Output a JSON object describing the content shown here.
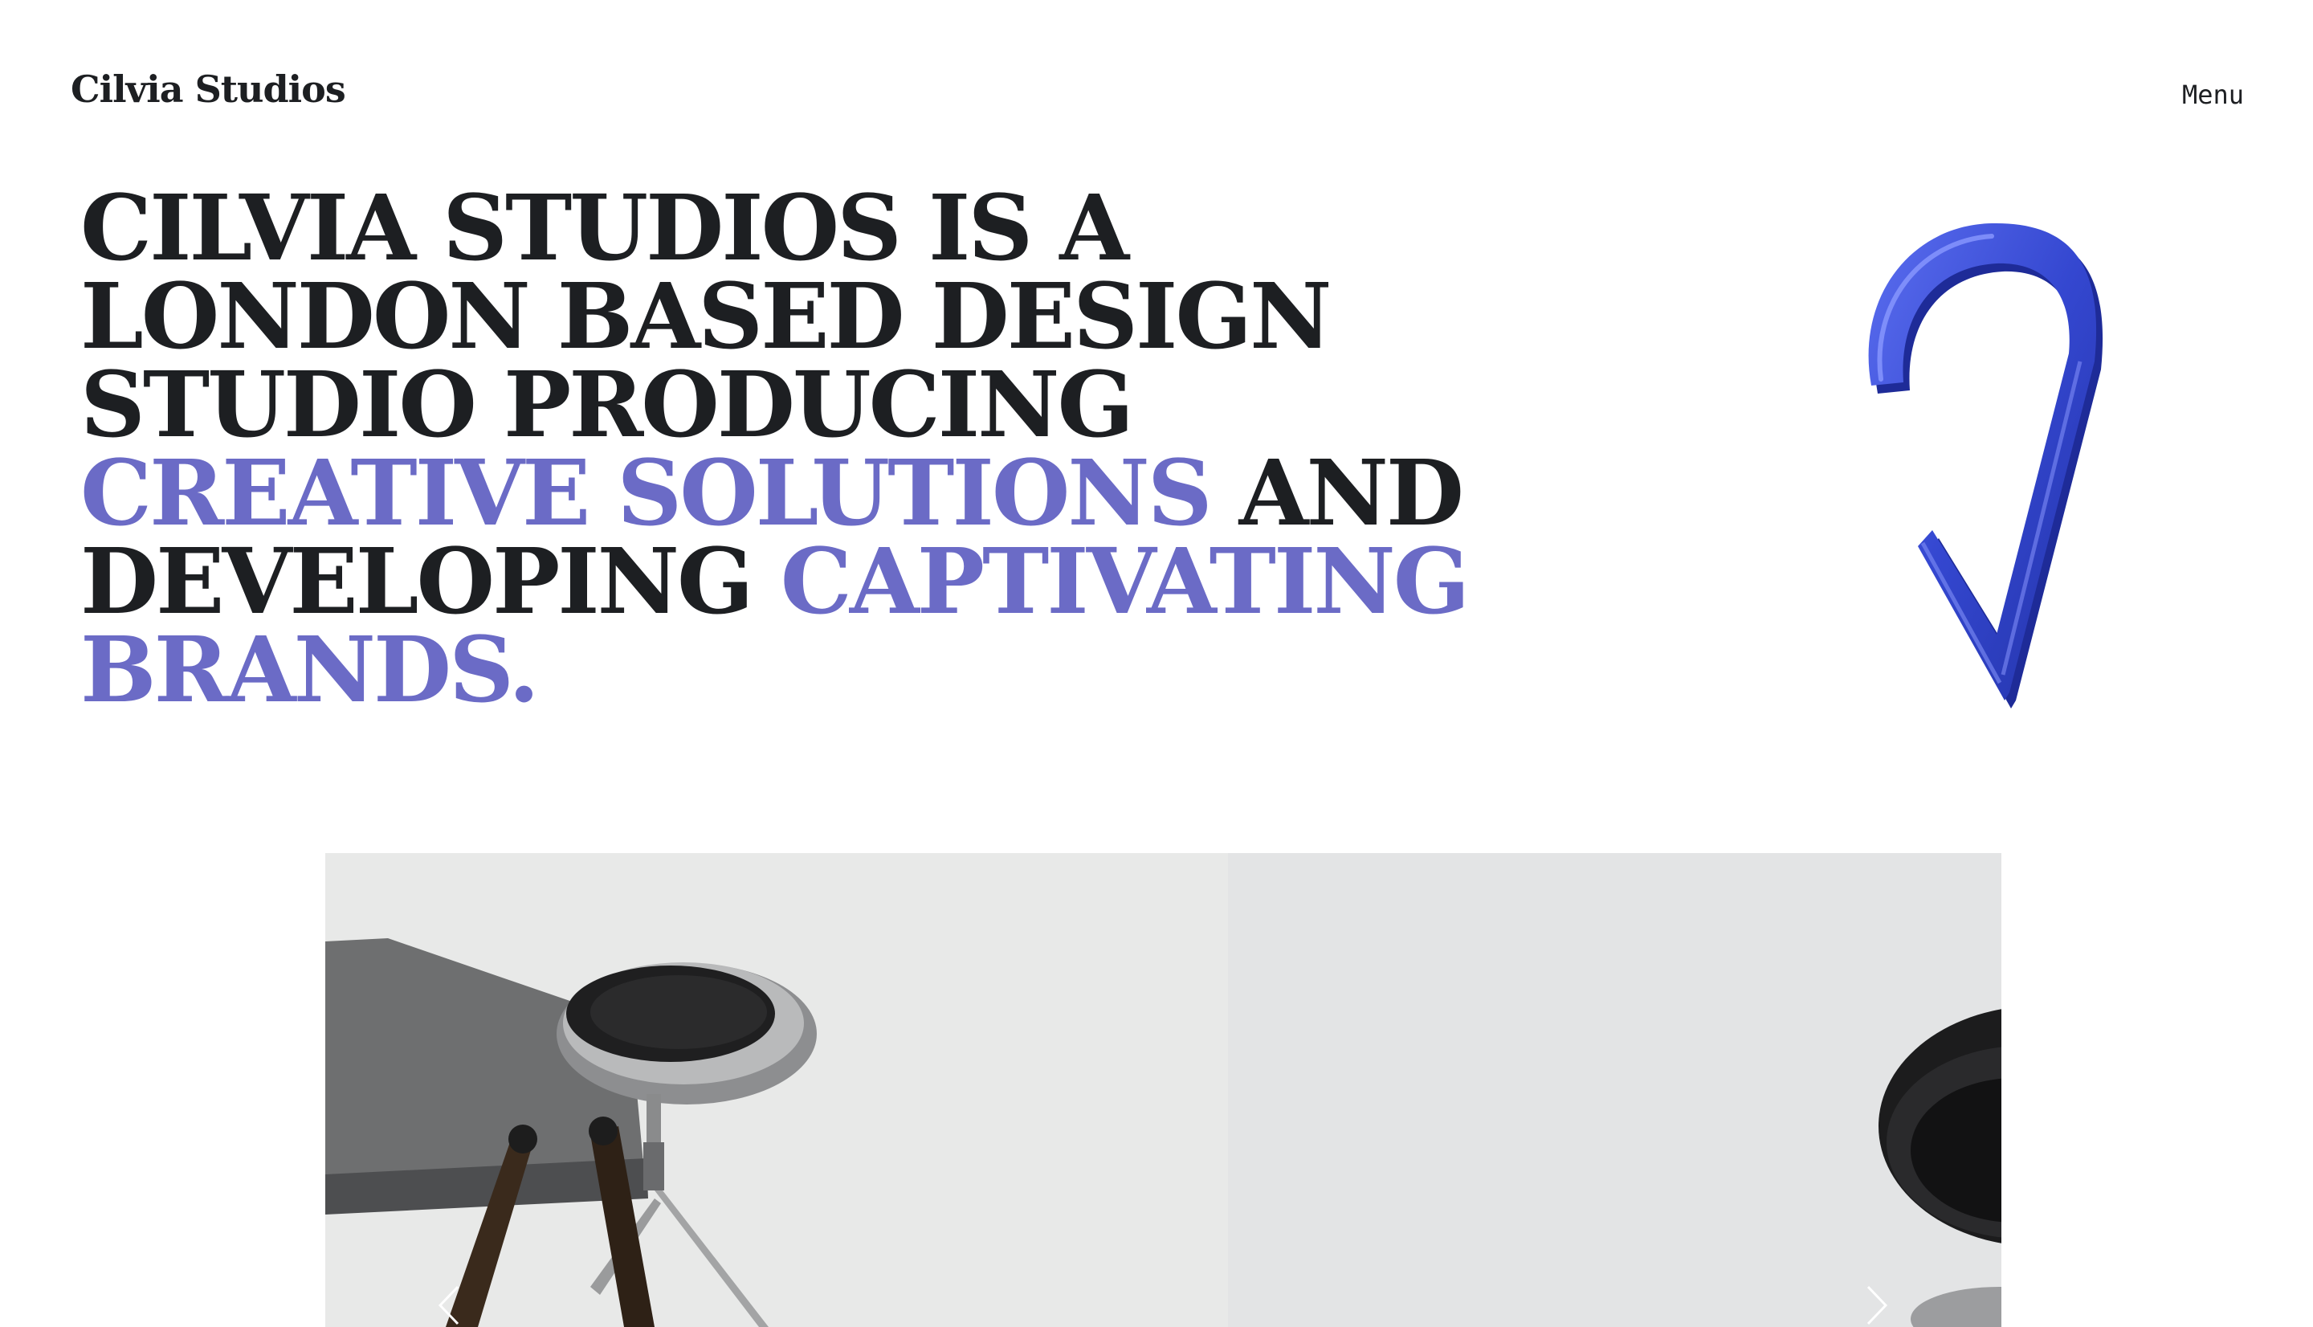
{
  "brand": {
    "logo_text": "Cilvia Studios"
  },
  "nav": {
    "menu_label": "Menu"
  },
  "colors": {
    "accent": "#6b6bc6",
    "dark": "#1d1f22",
    "hook": "#3a4fd1"
  },
  "hero": {
    "lines": [
      [
        {
          "text": "Cilvia Studios is a",
          "accent": false
        }
      ],
      [
        {
          "text": "London based design",
          "accent": false
        }
      ],
      [
        {
          "text": "studio producing",
          "accent": false
        }
      ],
      [
        {
          "text": "creative solutions",
          "accent": true
        },
        {
          "text": " and",
          "accent": false
        }
      ],
      [
        {
          "text": "developing ",
          "accent": false
        },
        {
          "text": "captivating",
          "accent": true
        }
      ],
      [
        {
          "text": "brands.",
          "accent": true
        }
      ]
    ]
  },
  "hero_graphic": {
    "icon": "blue-hook-icon"
  },
  "slider": {
    "slides": [
      {
        "name": "drum-stool-render"
      },
      {
        "name": "speaker-render"
      }
    ],
    "prev_icon": "chevron-left-icon",
    "next_icon": "chevron-right-icon"
  }
}
